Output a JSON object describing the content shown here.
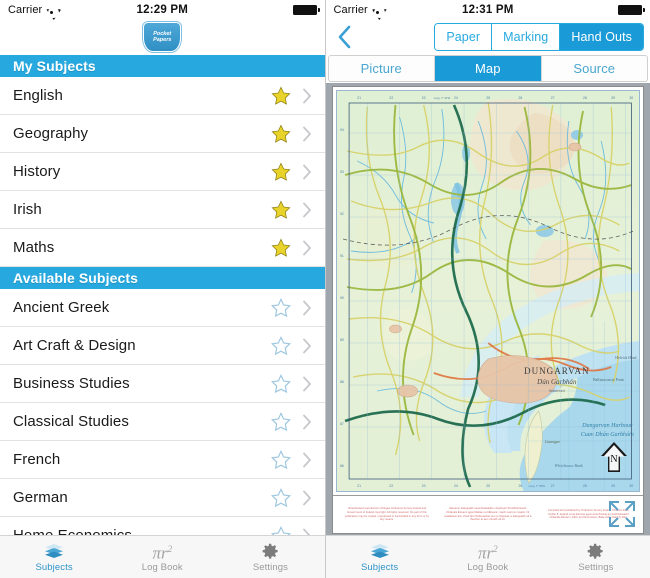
{
  "left": {
    "status": {
      "carrier": "Carrier",
      "time": "12:29 PM"
    },
    "logo": {
      "line1": "Pocket",
      "line2": "Papers"
    },
    "sections": [
      {
        "title": "My Subjects",
        "rows": [
          {
            "label": "English",
            "starred": true
          },
          {
            "label": "Geography",
            "starred": true
          },
          {
            "label": "History",
            "starred": true
          },
          {
            "label": "Irish",
            "starred": true
          },
          {
            "label": "Maths",
            "starred": true
          }
        ]
      },
      {
        "title": "Available Subjects",
        "rows": [
          {
            "label": "Ancient Greek",
            "starred": false
          },
          {
            "label": "Art Craft & Design",
            "starred": false
          },
          {
            "label": "Business Studies",
            "starred": false
          },
          {
            "label": "Classical Studies",
            "starred": false
          },
          {
            "label": "French",
            "starred": false
          },
          {
            "label": "German",
            "starred": false
          },
          {
            "label": "Home Economics",
            "starred": false
          }
        ]
      }
    ],
    "tabs": [
      {
        "label": "Subjects",
        "active": true
      },
      {
        "label": "Log Book",
        "active": false
      },
      {
        "label": "Settings",
        "active": false
      }
    ]
  },
  "right": {
    "status": {
      "carrier": "Carrier",
      "time": "12:31 PM"
    },
    "nav": {
      "back_label": "Back",
      "segments": [
        {
          "label": "Paper",
          "selected": false
        },
        {
          "label": "Marking",
          "selected": false
        },
        {
          "label": "Hand Outs",
          "selected": true
        }
      ]
    },
    "subsegments": [
      {
        "label": "Picture",
        "selected": false
      },
      {
        "label": "Map",
        "selected": true
      },
      {
        "label": "Source",
        "selected": false
      }
    ],
    "map": {
      "place_name": "DUNGARVAN",
      "place_name_irish": "Dún Garbhán",
      "place_sub": "Waterford",
      "bay_label_en": "Dungarvan Harbour",
      "bay_label_ga": "Cuan Dhún Garbháin",
      "feature_1": "Cunnigar",
      "feature_2": "Whitehouse Bank",
      "feature_3": "Ballynacourty Point",
      "feature_4": "Helvick Head",
      "north_letter": "N",
      "grid_labels_top": [
        "21",
        "22",
        "23",
        "24",
        "25",
        "26",
        "27",
        "28",
        "29",
        "30"
      ],
      "grid_labels_side": [
        "94",
        "93",
        "92",
        "91",
        "90",
        "89",
        "88",
        "87",
        "86"
      ],
      "grid_note_top": "Long. 7° 40'W",
      "grid_note_bottom": "Long. 7° 35'W",
      "footer_left": "Unauthorised reproduction infringes Ordnance Survey Ireland and Government of Ireland copyright. All rights reserved. No part of this publication may be copied, reproduced or transmitted in any form or by any means.",
      "footer_centre": "Sáraíonn atáirgeadh neamhúdaraithe cóipcheart Shuirbhéireacht Ordanáis Éireann agus Rialtas na hÉireann. Gach ceart ar cosaint. Ní ceadaítear aon chuid den fhoilseachán seo a chóipeáil, a atáirgeadh ná a tharchur ar aon mhodh ná slí.",
      "footer_right": "Compiled and published by Ordnance Survey Ireland, Phoenix Park, Dublin 8, Ireland. Arna thiomsú agus arna fhoilsiú ag Suirbhéireacht Ordanáis Éireann, Páirc an Fhionnuisce, Baile Átha Cliath 8, Éire."
    },
    "tabs": [
      {
        "label": "Subjects",
        "active": true
      },
      {
        "label": "Log Book",
        "active": false
      },
      {
        "label": "Settings",
        "active": false
      }
    ]
  },
  "colors": {
    "accent": "#27a9df",
    "accent_selected": "#1b9ad8",
    "star_filled": "#e8d32a",
    "star_empty": "#9ec8e0",
    "chevron": "#c7c7cc",
    "tab_active": "#2f93c9",
    "tab_inactive": "#9a9a9a"
  }
}
